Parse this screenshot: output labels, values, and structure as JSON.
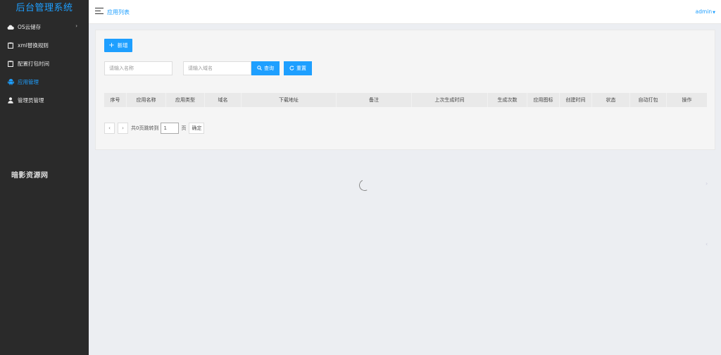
{
  "app": {
    "title": "后台管理系统",
    "watermark": "暗影资源网"
  },
  "sidebar": {
    "items": [
      {
        "label": "OS云储存",
        "icon": "cloud-icon",
        "has_submenu": true
      },
      {
        "label": "xml替换规则",
        "icon": "clipboard-icon"
      },
      {
        "label": "配置打包时间",
        "icon": "clipboard-icon"
      },
      {
        "label": "应用管理",
        "icon": "android-icon",
        "active": true
      },
      {
        "label": "管理员管理",
        "icon": "user-icon"
      }
    ]
  },
  "header": {
    "page_title": "应用列表",
    "user": "admin"
  },
  "toolbar": {
    "add_label": "新增"
  },
  "search": {
    "name_placeholder": "请输入名称",
    "domain_placeholder": "请输入域名",
    "search_label": "查询",
    "reset_label": "重置"
  },
  "table": {
    "columns": [
      "序号",
      "应用名称",
      "应用类型",
      "域名",
      "下载地址",
      "备注",
      "上次生成时间",
      "生成次数",
      "应用图标",
      "创建时间",
      "状态",
      "自动打包",
      "操作"
    ],
    "rows": []
  },
  "pagination": {
    "prev": "‹",
    "next": "›",
    "total_text": "共0页跳转到",
    "page_value": "1",
    "page_unit": "页",
    "confirm_label": "确定"
  },
  "colors": {
    "accent": "#1e9fff",
    "sidebar_bg": "#2a2a2a"
  }
}
